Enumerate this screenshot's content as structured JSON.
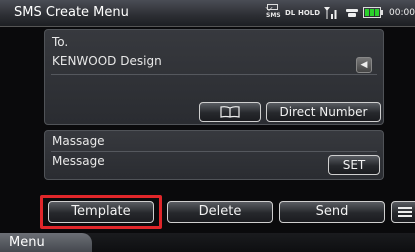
{
  "header": {
    "title": "SMS Create Menu",
    "status": {
      "sms_label": "SMS",
      "dl_label": "DL",
      "hold_label": "HOLD",
      "clock": "00:00"
    }
  },
  "to_section": {
    "label": "To.",
    "value": "KENWOOD Design",
    "contact_icon": "contact-icon",
    "phonebook_icon": "book-icon",
    "direct_number_label": "Direct Number"
  },
  "message_section": {
    "label": "Massage",
    "value": "Message",
    "set_label": "SET"
  },
  "actions": {
    "template_label": "Template",
    "delete_label": "Delete",
    "send_label": "Send"
  },
  "footer": {
    "menu_label": "Menu"
  },
  "colors": {
    "highlight": "#e0262a",
    "panel": "#2f3136",
    "header": "#3a3d44"
  }
}
